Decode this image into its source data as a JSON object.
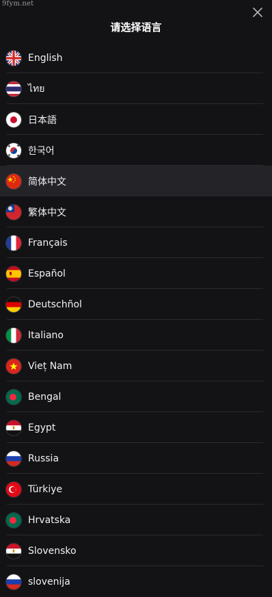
{
  "watermark": "9fym.net",
  "dialog": {
    "title": "请选择语言",
    "close_icon": "close-icon"
  },
  "languages": [
    {
      "label": "English",
      "flag": "uk-flag-icon"
    },
    {
      "label": "ไทย",
      "flag": "thailand-flag-icon"
    },
    {
      "label": "日本語",
      "flag": "japan-flag-icon"
    },
    {
      "label": "한국어",
      "flag": "korea-flag-icon"
    },
    {
      "label": "简体中文",
      "flag": "china-flag-icon",
      "selected": true
    },
    {
      "label": "繁体中文",
      "flag": "taiwan-flag-icon"
    },
    {
      "label": "Français",
      "flag": "france-flag-icon"
    },
    {
      "label": "Español",
      "flag": "spain-flag-icon"
    },
    {
      "label": "Deutschñol",
      "flag": "germany-flag-icon"
    },
    {
      "label": "Italiano",
      "flag": "italy-flag-icon"
    },
    {
      "label": "Vieț Nam",
      "flag": "vietnam-flag-icon"
    },
    {
      "label": "Bengal",
      "flag": "bangladesh-flag-icon"
    },
    {
      "label": "Egypt",
      "flag": "egypt-flag-icon"
    },
    {
      "label": "Russia",
      "flag": "russia-flag-icon"
    },
    {
      "label": "Türkiye",
      "flag": "turkey-flag-icon"
    },
    {
      "label": "Hrvatska",
      "flag": "bangladesh-flag-icon"
    },
    {
      "label": "Slovensko",
      "flag": "egypt-flag-icon"
    },
    {
      "label": "slovenija",
      "flag": "russia-flag-icon"
    }
  ],
  "colors": {
    "background": "#131316",
    "selected_row": "#232328",
    "divider": "#2b2b30",
    "text": "#f2f2f4"
  }
}
